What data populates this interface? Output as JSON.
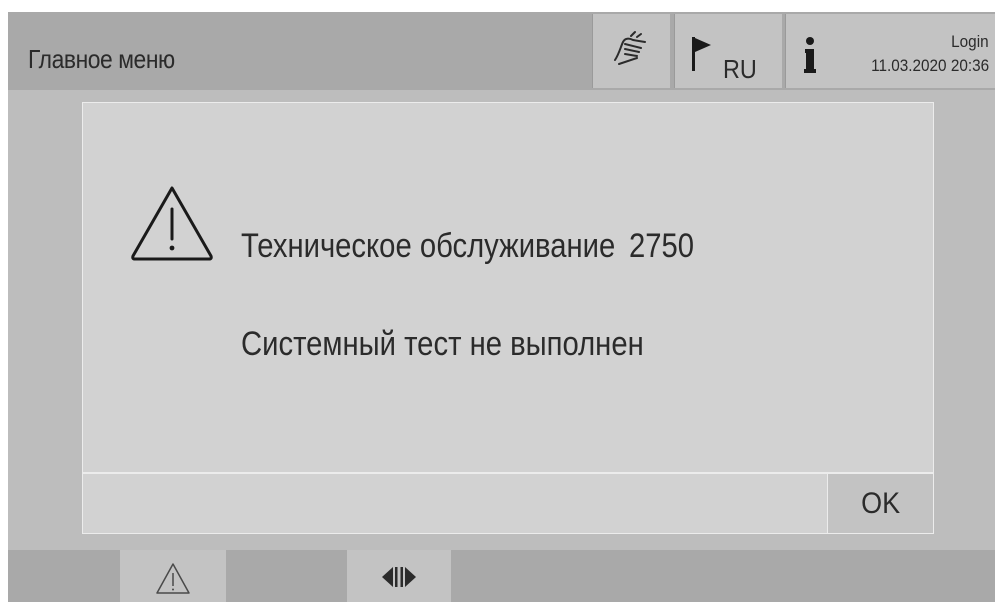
{
  "header": {
    "title": "Главное меню",
    "language": "RU",
    "login_label": "Login",
    "date": "11.03.2020",
    "time": "20:36"
  },
  "dialog": {
    "title": "Техническое обслуживание",
    "code": "2750",
    "message": "Системный тест не выполнен",
    "ok_label": "OK",
    "icon": "warning-triangle-icon"
  },
  "bottom_bar": {
    "icons": [
      "warning-triangle-icon",
      "left-right-arrows-icon"
    ]
  },
  "colors": {
    "screen_bg": "#bdbdbd",
    "header_bg": "#a9a9a9",
    "button_bg": "#c3c3c3",
    "dialog_bg": "#d2d2d2",
    "text": "#2b2b2b"
  }
}
